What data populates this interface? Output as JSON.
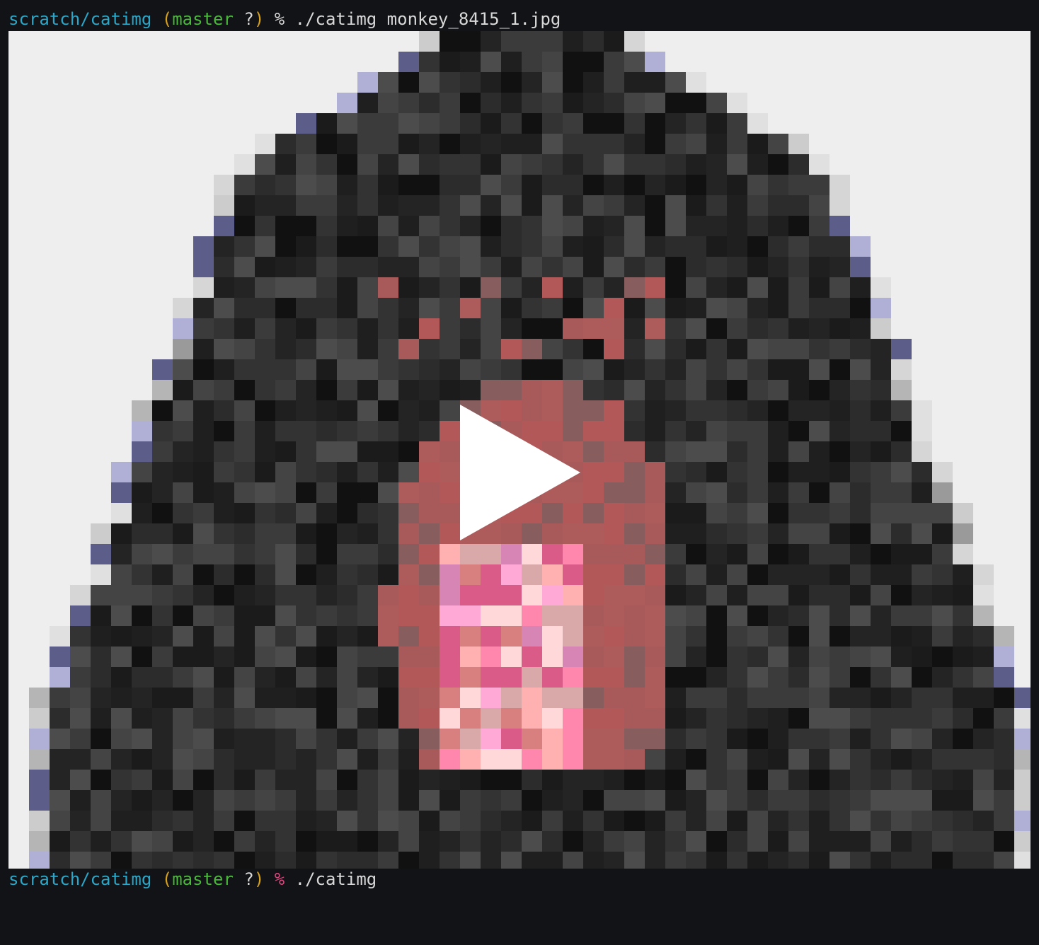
{
  "terminal": {
    "line1": {
      "path": "scratch/catimg",
      "paren_open": "(",
      "branch": "master",
      "status": "?",
      "paren_close": ")",
      "symbol": "%",
      "command": "./catimg monkey_8415_1.jpg"
    },
    "line2": {
      "path": "scratch/catimg",
      "paren_open": "(",
      "branch": "master",
      "status": "?",
      "paren_close": ")",
      "symbol": "%",
      "command": "./catimg"
    }
  },
  "image": {
    "subject": "pixelated gorilla portrait",
    "background_color": "#eeeeee",
    "overlay_icon": "play-icon"
  },
  "colors": {
    "path": "#2aa7c9",
    "branch": "#49b83a",
    "paren": "#d8a21c",
    "symbol_active": "#e0467e",
    "terminal_bg": "#121316",
    "text": "#d8d8d8"
  }
}
